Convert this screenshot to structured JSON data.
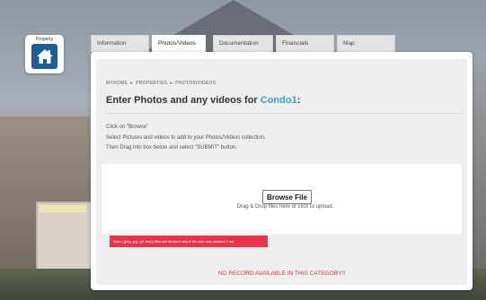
{
  "logo": {
    "label": "Property",
    "icon": "home-icon",
    "tile_color": "#1b5d99"
  },
  "tabs": [
    {
      "label": "Information",
      "active": false
    },
    {
      "label": "Photos/Videos",
      "active": true
    },
    {
      "label": "Documentation",
      "active": false
    },
    {
      "label": "Financials",
      "active": false
    },
    {
      "label": "Map",
      "active": false
    }
  ],
  "breadcrumb": [
    "MYHOME",
    "PROPERTIES",
    "PHOTOS/VIDEOS"
  ],
  "heading": {
    "prefix": "Enter Photos and any videos for ",
    "highlight": "Condo1",
    "suffix": ":"
  },
  "instructions": [
    "Click on \"Browse\"",
    "Select Pictures and videos to add to your Photos/Videos collection.",
    "Then Drag into box below and select \"SUBMIT\" button."
  ],
  "upload": {
    "button_label": "Browse File",
    "hint": "Drag & Drop files here or click to upload."
  },
  "note": "Note:( jpeg, jpg, gif ,bmp) files are allowed only & file size only allowed 2 mb",
  "empty_message": "NO RECORD AVAILABLE IN THIS CATEGORY!!",
  "colors": {
    "accent": "#3a9bd8",
    "alert": "#e8344a"
  }
}
